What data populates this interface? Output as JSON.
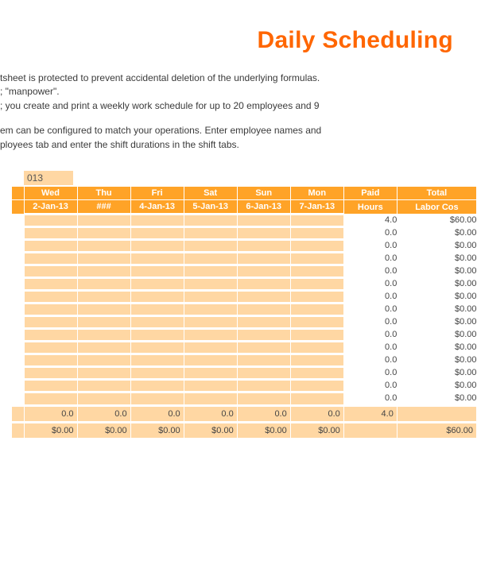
{
  "title": "Daily Scheduling",
  "intro": {
    "line1": "tsheet is protected to prevent accidental deletion of the underlying formulas.",
    "line2": "; \"manpower\".",
    "line3": "; you create and print a weekly work schedule for up to 20 employees and 9",
    "line4": "em can be configured to match your operations. Enter employee names and",
    "line5": "ployees tab and enter the shift durations in the shift tabs."
  },
  "weekStart": "013",
  "header1": {
    "c1": "Wed",
    "c2": "Thu",
    "c3": "Fri",
    "c4": "Sat",
    "c5": "Sun",
    "c6": "Mon",
    "c7": "Paid",
    "c8": "Total"
  },
  "header2": {
    "c1": "2-Jan-13",
    "c2": "###",
    "c3": "4-Jan-13",
    "c4": "5-Jan-13",
    "c5": "6-Jan-13",
    "c6": "7-Jan-13",
    "c7": "Hours",
    "c8": "Labor Cos"
  },
  "rows": [
    {
      "hours": "4.0",
      "cost": "$60.00"
    },
    {
      "hours": "0.0",
      "cost": "$0.00"
    },
    {
      "hours": "0.0",
      "cost": "$0.00"
    },
    {
      "hours": "0.0",
      "cost": "$0.00"
    },
    {
      "hours": "0.0",
      "cost": "$0.00"
    },
    {
      "hours": "0.0",
      "cost": "$0.00"
    },
    {
      "hours": "0.0",
      "cost": "$0.00"
    },
    {
      "hours": "0.0",
      "cost": "$0.00"
    },
    {
      "hours": "0.0",
      "cost": "$0.00"
    },
    {
      "hours": "0.0",
      "cost": "$0.00"
    },
    {
      "hours": "0.0",
      "cost": "$0.00"
    },
    {
      "hours": "0.0",
      "cost": "$0.00"
    },
    {
      "hours": "0.0",
      "cost": "$0.00"
    },
    {
      "hours": "0.0",
      "cost": "$0.00"
    },
    {
      "hours": "0.0",
      "cost": "$0.00"
    }
  ],
  "totalsHours": {
    "c1": "0.0",
    "c2": "0.0",
    "c3": "0.0",
    "c4": "0.0",
    "c5": "0.0",
    "c6": "0.0",
    "paid": "4.0",
    "cost": ""
  },
  "totalsCost": {
    "c1": "$0.00",
    "c2": "$0.00",
    "c3": "$0.00",
    "c4": "$0.00",
    "c5": "$0.00",
    "c6": "$0.00",
    "paid": "",
    "cost": "$60.00"
  },
  "chart_data": {
    "type": "table",
    "title": "Daily Scheduling",
    "column_headers_row1": [
      "Wed",
      "Thu",
      "Fri",
      "Sat",
      "Sun",
      "Mon",
      "Paid",
      "Total"
    ],
    "column_headers_row2": [
      "2-Jan-13",
      "###",
      "4-Jan-13",
      "5-Jan-13",
      "6-Jan-13",
      "7-Jan-13",
      "Hours",
      "Labor Cos"
    ],
    "paid_hours": [
      4.0,
      0.0,
      0.0,
      0.0,
      0.0,
      0.0,
      0.0,
      0.0,
      0.0,
      0.0,
      0.0,
      0.0,
      0.0,
      0.0,
      0.0
    ],
    "labor_cost": [
      60.0,
      0.0,
      0.0,
      0.0,
      0.0,
      0.0,
      0.0,
      0.0,
      0.0,
      0.0,
      0.0,
      0.0,
      0.0,
      0.0,
      0.0
    ],
    "day_totals_hours": {
      "Wed": 0.0,
      "Thu": 0.0,
      "Fri": 0.0,
      "Sat": 0.0,
      "Sun": 0.0,
      "Mon": 0.0,
      "Paid": 4.0
    },
    "day_totals_cost": {
      "Wed": 0.0,
      "Thu": 0.0,
      "Fri": 0.0,
      "Sat": 0.0,
      "Sun": 0.0,
      "Mon": 0.0,
      "Total": 60.0
    }
  }
}
